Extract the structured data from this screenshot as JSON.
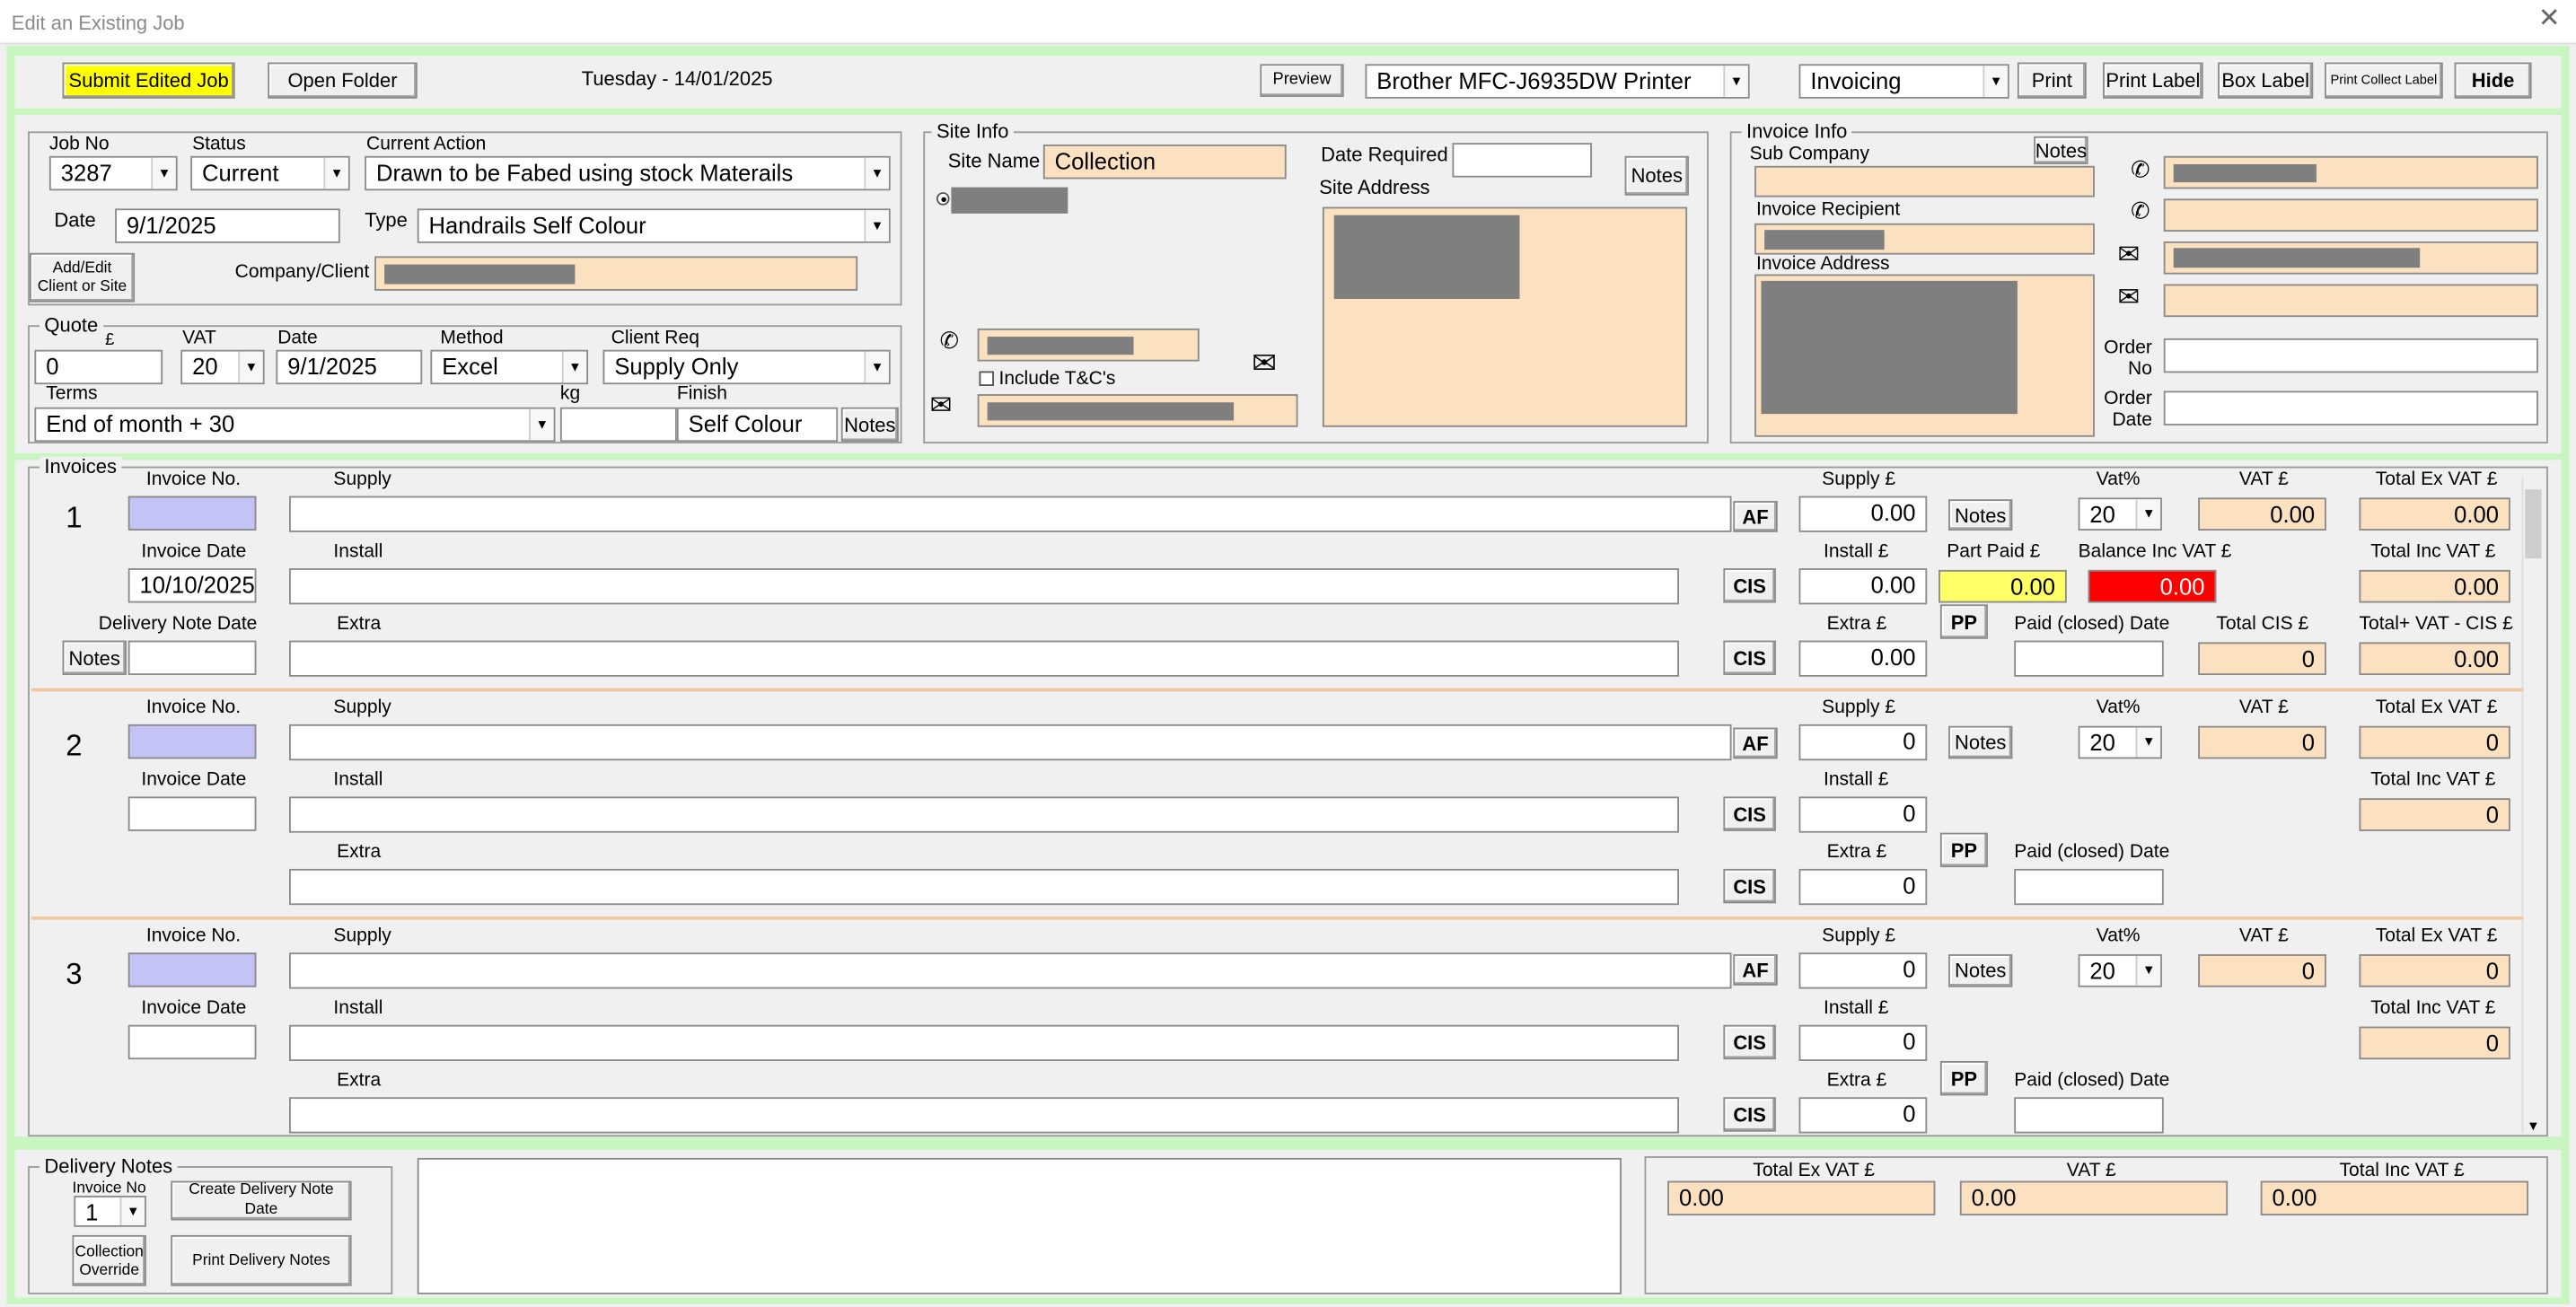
{
  "window": {
    "title": "Edit an Existing Job",
    "close_glyph": "✕"
  },
  "toolbar": {
    "submit_label": "Submit Edited Job",
    "open_folder_label": "Open Folder",
    "date_text": "Tuesday - 14/01/2025",
    "preview_label": "Preview",
    "printer": "Brother MFC-J6935DW Printer",
    "print_mode": "Invoicing",
    "print_label": "Print",
    "print_label_label": "Print Label",
    "box_label_label": "Box Label",
    "print_collect_label": "Print Collect Label",
    "hide_label": "Hide"
  },
  "job": {
    "job_no_label": "Job No",
    "job_no": "3287",
    "status_label": "Status",
    "status": "Current",
    "current_action_label": "Current Action",
    "current_action": "Drawn to be Fabed using stock Materails",
    "date_label": "Date",
    "date": "9/1/2025",
    "type_label": "Type",
    "type": "Handrails Self Colour",
    "add_edit_label": "Add/Edit Client or Site",
    "company_label": "Company/Client"
  },
  "quote": {
    "legend": "Quote",
    "pound_label": "£",
    "amount": "0",
    "vat_label": "VAT",
    "vat": "20",
    "date_label": "Date",
    "date": "9/1/2025",
    "method_label": "Method",
    "method": "Excel",
    "client_req_label": "Client Req",
    "client_req": "Supply Only",
    "terms_label": "Terms",
    "terms": "End of month + 30",
    "kg_label": "kg",
    "kg": "",
    "finish_label": "Finish",
    "finish": "Self Colour",
    "notes_label": "Notes"
  },
  "site": {
    "legend": "Site Info",
    "site_name_label": "Site Name",
    "site_name": "Collection",
    "date_required_label": "Date Required",
    "date_required": "",
    "notes_label": "Notes",
    "site_address_label": "Site Address",
    "include_tc_label": "Include T&C's"
  },
  "invoice_info": {
    "legend": "Invoice Info",
    "sub_company_label": "Sub Company",
    "notes_label": "Notes",
    "recipient_label": "Invoice Recipient",
    "address_label": "Invoice Address",
    "order_no_label": "Order No",
    "order_date_label": "Order Date"
  },
  "labels": {
    "invoices_legend": "Invoices",
    "invoice_no": "Invoice No.",
    "invoice_date": "Invoice Date",
    "delivery_note_date": "Delivery Note Date",
    "supply": "Supply",
    "install": "Install",
    "extra": "Extra",
    "supply_gbp": "Supply £",
    "install_gbp": "Install £",
    "extra_gbp": "Extra £",
    "notes": "Notes",
    "vat_pct": "Vat%",
    "vat_gbp": "VAT £",
    "total_ex_vat": "Total Ex VAT £",
    "total_inc_vat": "Total Inc VAT £",
    "part_paid": "Part Paid £",
    "balance_inc_vat": "Balance Inc VAT £",
    "paid_closed_date": "Paid (closed) Date",
    "total_cis": "Total  CIS £",
    "total_vat_cis": "Total+ VAT - CIS £",
    "af": "AF",
    "cis": "CIS",
    "pp": "PP"
  },
  "invoices": [
    {
      "index": "1",
      "invoice_date": "10/10/2025",
      "supply_amount": "0.00",
      "install_amount": "0.00",
      "extra_amount": "0.00",
      "vat_pct": "20",
      "vat_amount": "0.00",
      "total_ex_vat": "0.00",
      "total_inc_vat": "0.00",
      "part_paid": "0.00",
      "balance": "0.00",
      "total_cis": "0",
      "total_vat_cis": "0.00"
    },
    {
      "index": "2",
      "invoice_date": "",
      "supply_amount": "0",
      "install_amount": "0",
      "extra_amount": "0",
      "vat_pct": "20",
      "vat_amount": "0",
      "total_ex_vat": "0",
      "total_inc_vat": "0"
    },
    {
      "index": "3",
      "invoice_date": "",
      "supply_amount": "0",
      "install_amount": "0",
      "extra_amount": "0",
      "vat_pct": "20",
      "vat_amount": "0",
      "total_ex_vat": "0",
      "total_inc_vat": "0"
    }
  ],
  "delivery": {
    "legend": "Delivery Notes",
    "invoice_no_label": "Invoice No",
    "invoice_no": "1",
    "create_label": "Create Delivery Note Date",
    "collection_override_label": "Collection Override",
    "print_label": "Print Delivery Notes"
  },
  "totals": {
    "ex_vat_label": "Total Ex VAT £",
    "ex_vat": "0.00",
    "vat_label": "VAT £",
    "vat": "0.00",
    "inc_vat_label": "Total Inc VAT £",
    "inc_vat": "0.00"
  },
  "colors": {
    "frame_green": "#c8f5c0",
    "peach": "#fbe1c0",
    "lavender": "#c3c3f6",
    "yellow": "#ffff00",
    "red": "#ff0000"
  }
}
